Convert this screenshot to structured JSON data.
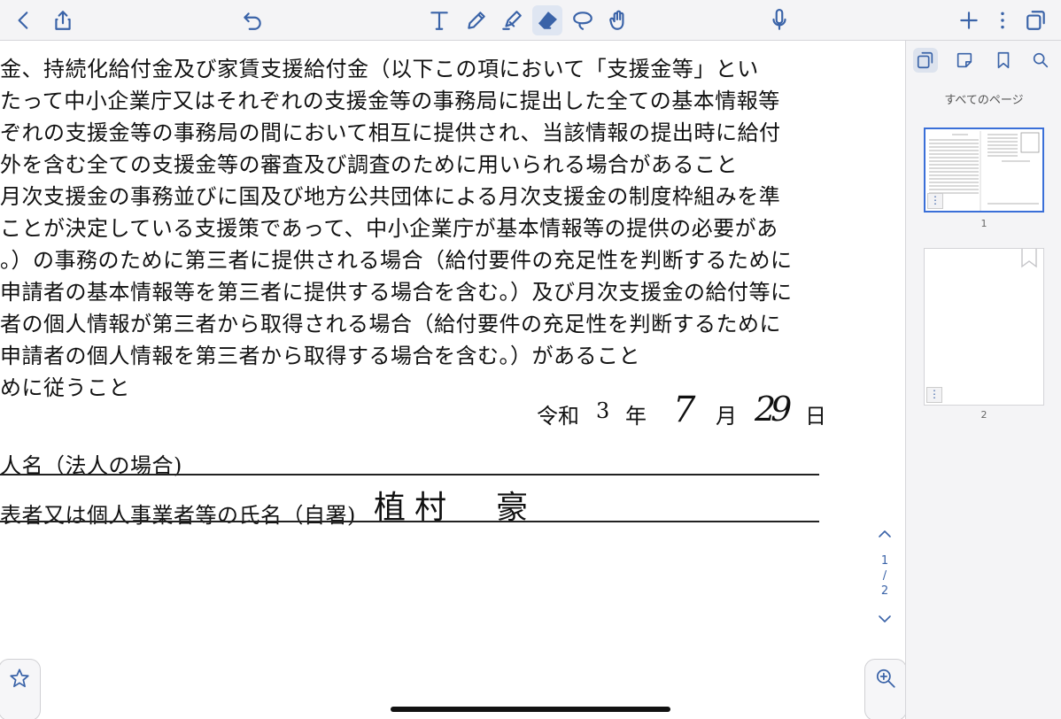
{
  "toolbar": {
    "left": [
      "back-icon",
      "share-icon",
      "undo-icon"
    ],
    "tools": [
      "text-tool-icon",
      "pen-icon",
      "highlighter-icon",
      "eraser-icon",
      "lasso-icon",
      "hand-icon"
    ],
    "right": [
      "microphone-icon",
      "add-page-icon",
      "more-icon",
      "pages-view-icon"
    ],
    "accent": "#3a63a8"
  },
  "document": {
    "lines": [
      "金、持続化給付金及び家賃支援給付金（以下この項において「支援金等」とい",
      "たって中小企業庁又はそれぞれの支援金等の事務局に提出した全ての基本情報等",
      "ぞれの支援金等の事務局の間において相互に提供され、当該情報の提出時に給付",
      "外を含む全ての支援金等の審査及び調査のために用いられる場合があること",
      "月次支援金の事務並びに国及び地方公共団体による月次支援金の制度枠組みを準",
      "ことが決定している支援策であって、中小企業庁が基本情報等の提供の必要があ",
      "。）の事務のために第三者に提供される場合（給付要件の充足性を判断するために",
      "申請者の基本情報等を第三者に提供する場合を含む。）及び月次支援金の給付等に",
      "者の個人情報が第三者から取得される場合（給付要件の充足性を判断するために",
      "申請者の個人情報を第三者から取得する場合を含む。）があること",
      "めに従うこと"
    ],
    "date": {
      "era": "令和",
      "year": "3",
      "year_unit": "年",
      "month": "7",
      "month_unit": "月",
      "day": "29",
      "day_unit": "日"
    },
    "corp_label": "人名（法人の場合)",
    "rep_label": "表者又は個人事業者等の氏名（自署)",
    "signature": "植村　豪"
  },
  "page_nav": {
    "current": "1",
    "separator": "/",
    "total": "2"
  },
  "sidebar": {
    "title": "すべてのページ",
    "tabs": [
      "pages-tab-icon",
      "notes-tab-icon",
      "bookmark-tab-icon",
      "search-tab-icon"
    ],
    "pages": [
      {
        "number": "1",
        "active": true
      },
      {
        "number": "2",
        "active": false
      }
    ],
    "menu_glyph": "⋮"
  }
}
